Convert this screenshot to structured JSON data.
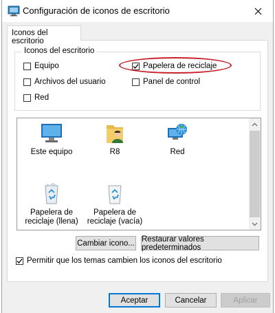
{
  "window": {
    "title": "Configuración de iconos de escritorio"
  },
  "tab": {
    "label": "Iconos del escritorio"
  },
  "group": {
    "label": "Iconos del escritorio",
    "checkboxes": [
      {
        "label": "Equipo",
        "checked": false
      },
      {
        "label": "Papelera de reciclaje",
        "checked": true
      },
      {
        "label": "Archivos del usuario",
        "checked": false
      },
      {
        "label": "Panel de control",
        "checked": false
      },
      {
        "label": "Red",
        "checked": false
      }
    ]
  },
  "icons": [
    {
      "label": "Este equipo",
      "icon": "computer-icon"
    },
    {
      "label": "R8",
      "icon": "user-folder-icon"
    },
    {
      "label": "Red",
      "icon": "network-icon"
    },
    {
      "label": "Papelera de reciclaje (llena)",
      "icon": "recycle-bin-full-icon"
    },
    {
      "label": "Papelera de reciclaje (vacía)",
      "icon": "recycle-bin-empty-icon"
    }
  ],
  "icon_lines": {
    "full_line1": "Papelera de",
    "full_line2": "reciclaje (llena)",
    "empty_line1": "Papelera de",
    "empty_line2": "reciclaje (vacía)"
  },
  "buttons": {
    "change_icon": "Cambiar icono...",
    "restore_defaults": "Restaurar valores predeterminados",
    "ok": "Aceptar",
    "cancel": "Cancelar",
    "apply": "Aplicar"
  },
  "themes_checkbox": {
    "label": "Permitir que los temas cambien los iconos del escritorio",
    "checked": true
  },
  "colors": {
    "accent": "#0078d7",
    "highlight_ellipse": "#c8202a"
  }
}
